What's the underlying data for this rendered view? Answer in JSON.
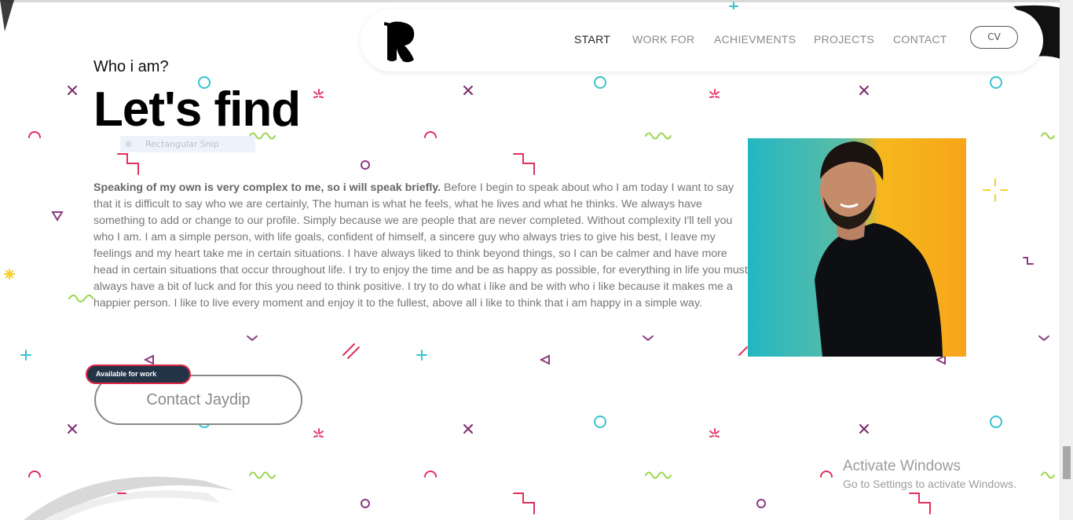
{
  "nav": {
    "items": [
      {
        "label": "START"
      },
      {
        "label": "WORK FOR"
      },
      {
        "label": "ACHIEVMENTS"
      },
      {
        "label": "PROJECTS"
      },
      {
        "label": "CONTACT"
      }
    ],
    "cv_label": "CV"
  },
  "hero": {
    "eyebrow": "Who i am?",
    "headline": "Let's find",
    "bio_lead": "Speaking of my own is very complex to me, so i will speak briefly.",
    "bio_body": " Before I begin to speak about who I am today I want to say that it is difficult to say who we are certainly, The human is what he feels, what he lives and what he thinks. We always have something to add or change to our profile. Simply because we are people that are never completed. Without complexity I'll tell you who I am. I am a simple person, with life goals, confident of himself, a sincere guy who always tries to give his best, I leave my feelings and my heart take me in certain situations. I have always liked to think beyond things, so I can be calmer and have more head in certain situations that occur throughout life. I try to enjoy the time and be as happy as possible, for everything in life you must always have a bit of luck and for this you need to think positive. I try to do what i like and be with who i like because it makes me a happier person. I like to live every moment and enjoy it to the fullest, above all i like to think that i am happy in a simple way.",
    "badge": "Available for work",
    "contact_button": "Contact Jaydip"
  },
  "overlay": {
    "snip_label": "Rectangular Snip"
  },
  "watermark": {
    "title": "Activate Windows",
    "subtitle": "Go to Settings to activate Windows."
  },
  "colors": {
    "badge_bg": "#243447",
    "badge_border": "#e02845",
    "photo_teal": "#26b6bd",
    "photo_yellow": "#f7b51f"
  }
}
